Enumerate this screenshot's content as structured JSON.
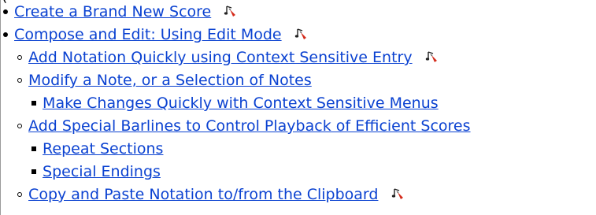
{
  "items": [
    {
      "level": 1,
      "marker": "disc",
      "text": "Create a Brand New Score",
      "icon": "tutorial-note-icon"
    },
    {
      "level": 1,
      "marker": "disc",
      "text": "Compose and Edit: Using Edit Mode",
      "icon": "tutorial-note-icon"
    },
    {
      "level": 2,
      "marker": "circle",
      "text": "Add Notation Quickly using Context Sensitive Entry",
      "icon": "tutorial-note-icon"
    },
    {
      "level": 2,
      "marker": "circle",
      "text": "Modify a Note, or a Selection of Notes",
      "icon": ""
    },
    {
      "level": 3,
      "marker": "square",
      "text": "Make Changes Quickly with Context Sensitive Menus",
      "icon": ""
    },
    {
      "level": 2,
      "marker": "circle",
      "text": "Add Special Barlines to Control Playback of Efficient Scores",
      "icon": ""
    },
    {
      "level": 3,
      "marker": "square",
      "text": "Repeat Sections",
      "icon": ""
    },
    {
      "level": 3,
      "marker": "square",
      "text": "Special Endings",
      "icon": ""
    },
    {
      "level": 2,
      "marker": "circle",
      "text": "Copy and Paste Notation to/from the Clipboard",
      "icon": "tutorial-note-icon"
    }
  ],
  "colors": {
    "link": "#0b42d1",
    "icon_accent": "#d42a1a"
  }
}
